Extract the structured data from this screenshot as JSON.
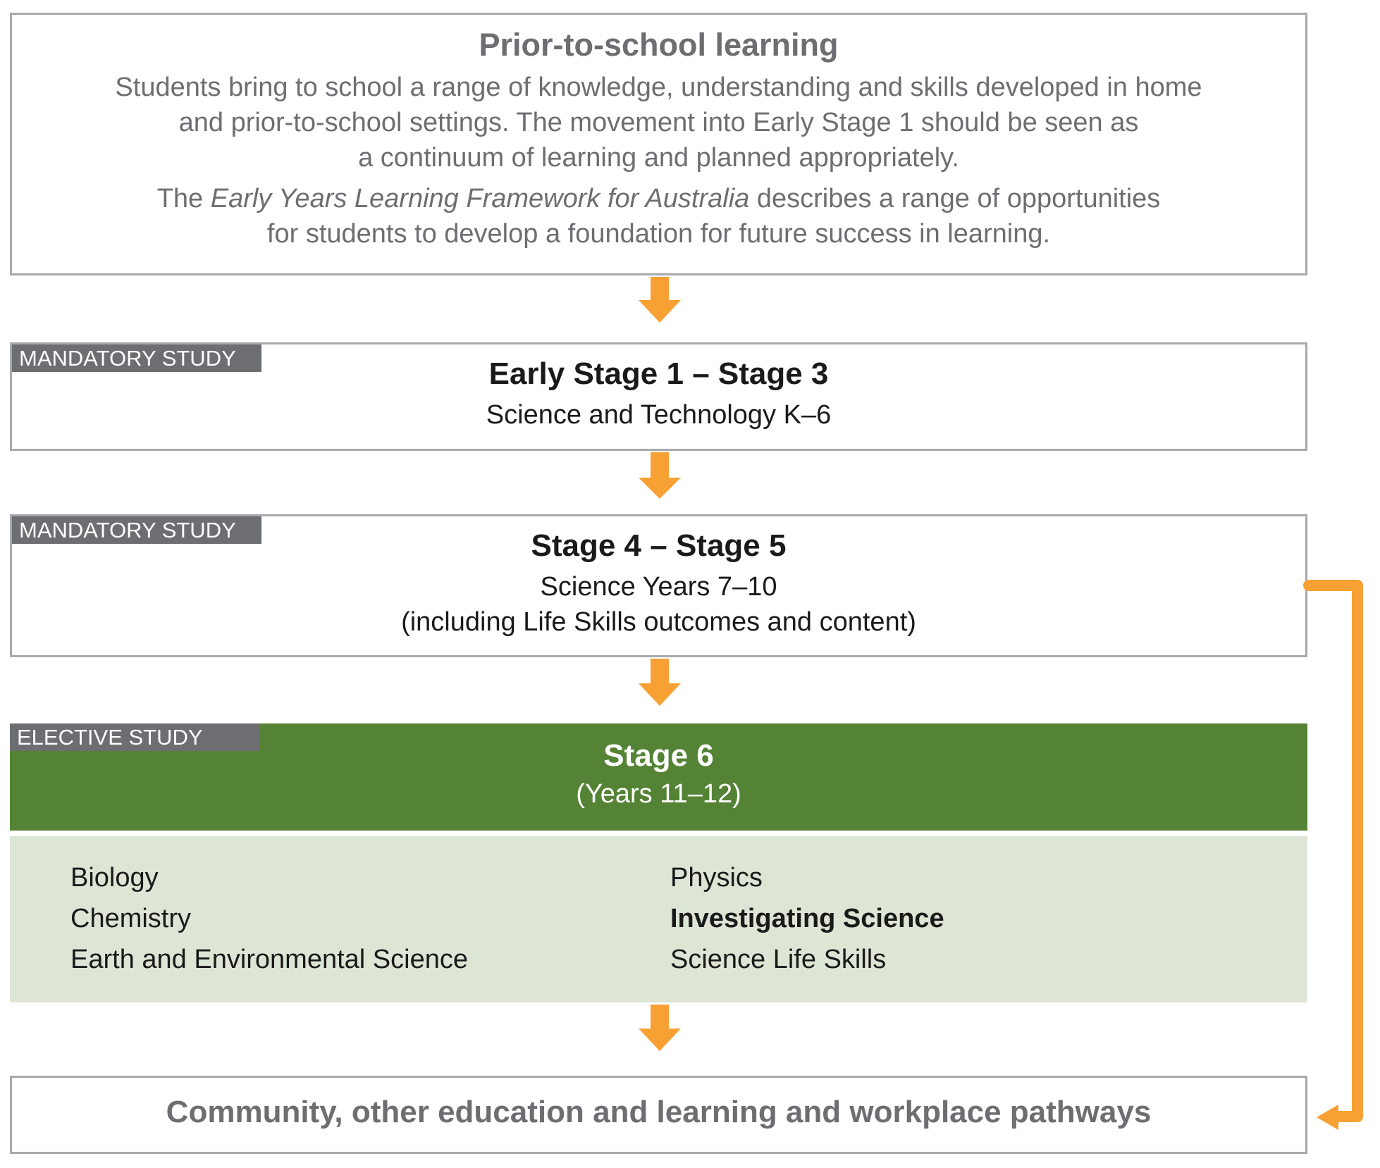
{
  "prior": {
    "title": "Prior-to-school learning",
    "para1": [
      "Students bring to school a range of knowledge, understanding and skills developed in home",
      "and prior-to-school settings. The movement into Early Stage 1 should be seen as",
      "a continuum of learning and planned appropriately."
    ],
    "para2_prefix": "The ",
    "para2_italic": "Early Years Learning Framework for Australia",
    "para2_suffix": " describes a range of opportunities",
    "para2_line2": "for students to develop a foundation for future success in learning."
  },
  "es1": {
    "tag": "MANDATORY STUDY",
    "title": "Early Stage 1 – Stage 3",
    "subtitle": "Science and Technology K–6"
  },
  "s45": {
    "tag": "MANDATORY STUDY",
    "title": "Stage 4 – Stage 5",
    "subtitle": "Science Years 7–10",
    "note": "(including Life Skills outcomes and content)"
  },
  "s6": {
    "tag": "ELECTIVE STUDY",
    "title": "Stage 6",
    "subtitle": "(Years 11–12)",
    "courses_left": [
      "Biology",
      "Chemistry",
      "Earth and Environmental Science"
    ],
    "courses_right": [
      "Physics",
      "Investigating Science",
      "Science Life Skills"
    ],
    "bold_course": "Investigating Science"
  },
  "final": {
    "title": "Community, other education and learning and workplace pathways"
  },
  "colors": {
    "arrow": "#f7a034",
    "border": "#a7a9ac",
    "tag": "#6d6e71",
    "stage6_band": "#548335",
    "courses_bg": "#dde6d5"
  }
}
